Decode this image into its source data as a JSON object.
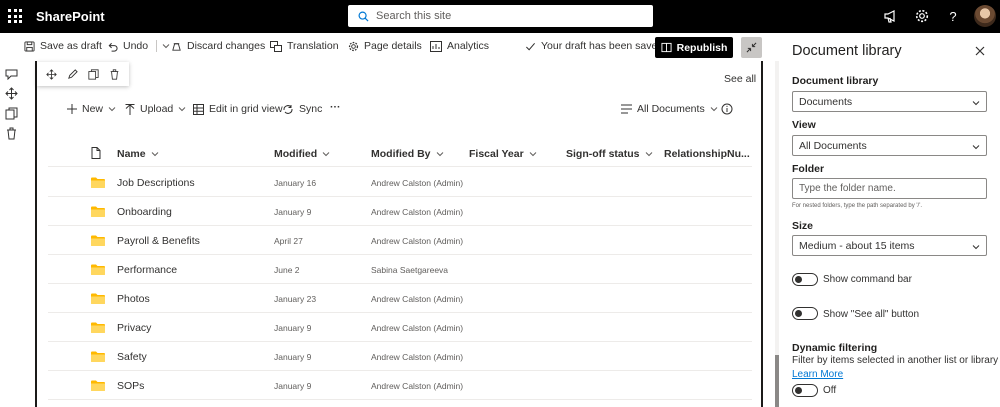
{
  "app": {
    "title": "SharePoint"
  },
  "search": {
    "placeholder": "Search this site"
  },
  "command_bar": {
    "save_draft": "Save as draft",
    "undo": "Undo",
    "discard": "Discard changes",
    "translation": "Translation",
    "page_details": "Page details",
    "analytics": "Analytics",
    "draft_status": "Your draft has been saved",
    "republish": "Republish"
  },
  "webpart": {
    "see_all": "See all"
  },
  "library_toolbar": {
    "new": "New",
    "upload": "Upload",
    "grid_view": "Edit in grid view",
    "sync": "Sync",
    "more": "···",
    "view": "All Documents"
  },
  "columns": [
    "Name",
    "Modified",
    "Modified By",
    "Fiscal Year",
    "Sign-off status",
    "RelationshipNu..."
  ],
  "rows": [
    {
      "name": "Job Descriptions",
      "modified": "January 16",
      "modified_by": "Andrew Calston (Admin)"
    },
    {
      "name": "Onboarding",
      "modified": "January 9",
      "modified_by": "Andrew Calston (Admin)"
    },
    {
      "name": "Payroll & Benefits",
      "modified": "April 27",
      "modified_by": "Andrew Calston (Admin)"
    },
    {
      "name": "Performance",
      "modified": "June 2",
      "modified_by": "Sabina Saetgareeva"
    },
    {
      "name": "Photos",
      "modified": "January 23",
      "modified_by": "Andrew Calston (Admin)"
    },
    {
      "name": "Privacy",
      "modified": "January 9",
      "modified_by": "Andrew Calston (Admin)"
    },
    {
      "name": "Safety",
      "modified": "January 9",
      "modified_by": "Andrew Calston (Admin)"
    },
    {
      "name": "SOPs",
      "modified": "January 9",
      "modified_by": "Andrew Calston (Admin)"
    }
  ],
  "panel": {
    "title": "Document library",
    "library_label": "Document library",
    "library_value": "Documents",
    "view_label": "View",
    "view_value": "All Documents",
    "folder_label": "Folder",
    "folder_placeholder": "Type the folder name.",
    "folder_hint": "For nested folders, type the path separated by '/'.",
    "size_label": "Size",
    "size_value": "Medium - about 15 items",
    "show_command_bar": "Show command bar",
    "show_see_all": "Show \"See all\" button",
    "dynamic_label": "Dynamic filtering",
    "dynamic_desc": "Filter by items selected in another list or library",
    "learn_more": "Learn More",
    "dynamic_state": "Off"
  },
  "colors": {
    "topbar": "#000000",
    "accent": "#0078d4",
    "folder": "#ffb900"
  }
}
